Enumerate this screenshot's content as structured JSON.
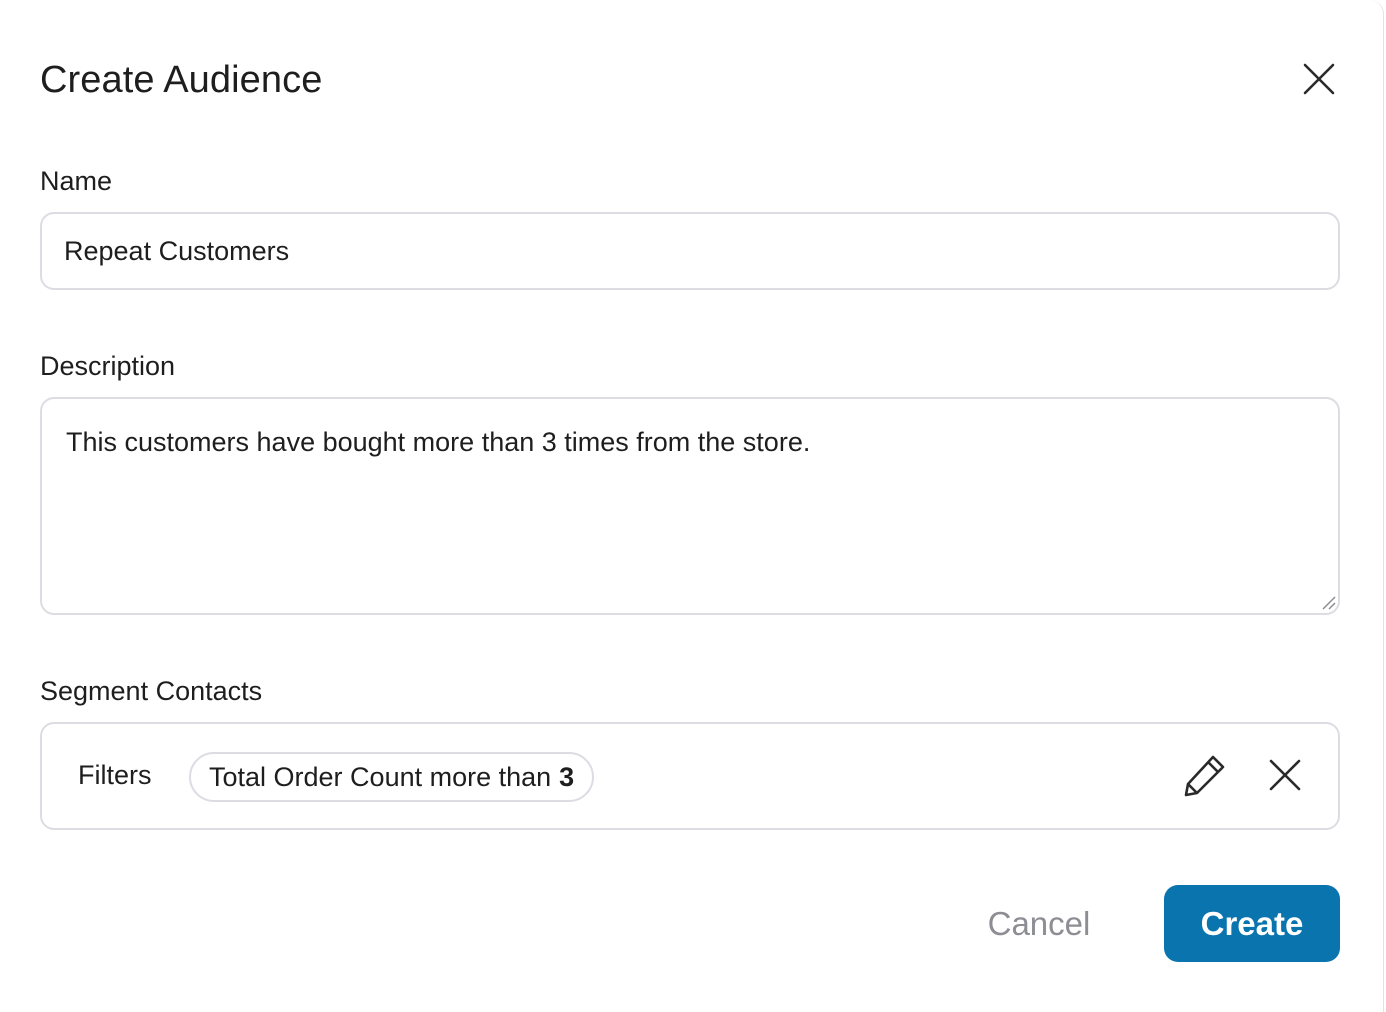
{
  "dialog": {
    "title": "Create Audience",
    "close_icon": "close-icon"
  },
  "name_field": {
    "label": "Name",
    "value": "Repeat Customers"
  },
  "description_field": {
    "label": "Description",
    "value": "This customers have bought more than 3 times from the store."
  },
  "segment": {
    "label": "Segment Contacts",
    "filters_label": "Filters",
    "filter_chip": {
      "text": "Total Order Count more than",
      "value": "3"
    },
    "edit_icon": "pencil-icon",
    "remove_icon": "close-icon"
  },
  "footer": {
    "cancel_label": "Cancel",
    "create_label": "Create"
  },
  "colors": {
    "primary": "#0a74ae",
    "border": "#dcdce3",
    "muted_text": "#8d8d94",
    "text": "#1e1e1e"
  }
}
